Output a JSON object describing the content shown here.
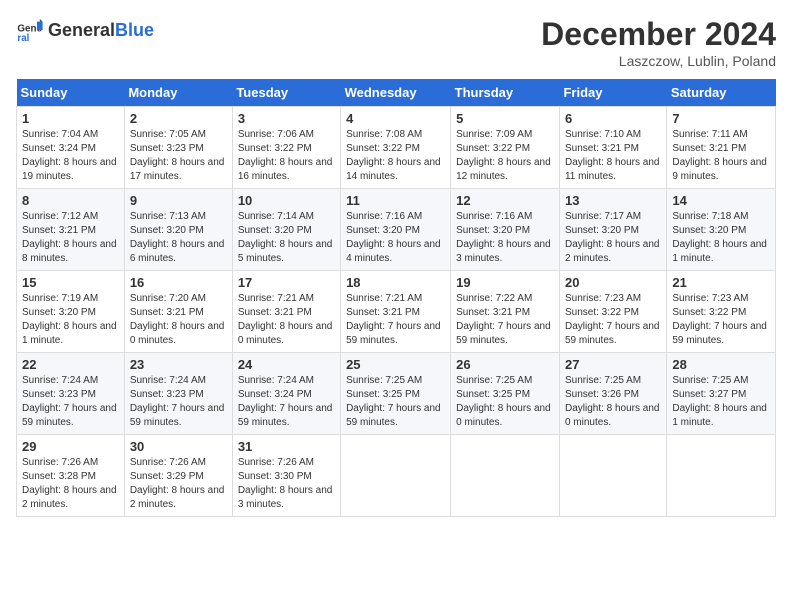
{
  "header": {
    "logo": {
      "general": "General",
      "blue": "Blue"
    },
    "title": "December 2024",
    "location": "Laszczow, Lublin, Poland"
  },
  "calendar": {
    "columns": [
      "Sunday",
      "Monday",
      "Tuesday",
      "Wednesday",
      "Thursday",
      "Friday",
      "Saturday"
    ],
    "weeks": [
      [
        {
          "day": "1",
          "sunrise": "7:04 AM",
          "sunset": "3:24 PM",
          "daylight": "8 hours and 19 minutes."
        },
        {
          "day": "2",
          "sunrise": "7:05 AM",
          "sunset": "3:23 PM",
          "daylight": "8 hours and 17 minutes."
        },
        {
          "day": "3",
          "sunrise": "7:06 AM",
          "sunset": "3:22 PM",
          "daylight": "8 hours and 16 minutes."
        },
        {
          "day": "4",
          "sunrise": "7:08 AM",
          "sunset": "3:22 PM",
          "daylight": "8 hours and 14 minutes."
        },
        {
          "day": "5",
          "sunrise": "7:09 AM",
          "sunset": "3:22 PM",
          "daylight": "8 hours and 12 minutes."
        },
        {
          "day": "6",
          "sunrise": "7:10 AM",
          "sunset": "3:21 PM",
          "daylight": "8 hours and 11 minutes."
        },
        {
          "day": "7",
          "sunrise": "7:11 AM",
          "sunset": "3:21 PM",
          "daylight": "8 hours and 9 minutes."
        }
      ],
      [
        {
          "day": "8",
          "sunrise": "7:12 AM",
          "sunset": "3:21 PM",
          "daylight": "8 hours and 8 minutes."
        },
        {
          "day": "9",
          "sunrise": "7:13 AM",
          "sunset": "3:20 PM",
          "daylight": "8 hours and 6 minutes."
        },
        {
          "day": "10",
          "sunrise": "7:14 AM",
          "sunset": "3:20 PM",
          "daylight": "8 hours and 5 minutes."
        },
        {
          "day": "11",
          "sunrise": "7:16 AM",
          "sunset": "3:20 PM",
          "daylight": "8 hours and 4 minutes."
        },
        {
          "day": "12",
          "sunrise": "7:16 AM",
          "sunset": "3:20 PM",
          "daylight": "8 hours and 3 minutes."
        },
        {
          "day": "13",
          "sunrise": "7:17 AM",
          "sunset": "3:20 PM",
          "daylight": "8 hours and 2 minutes."
        },
        {
          "day": "14",
          "sunrise": "7:18 AM",
          "sunset": "3:20 PM",
          "daylight": "8 hours and 1 minute."
        }
      ],
      [
        {
          "day": "15",
          "sunrise": "7:19 AM",
          "sunset": "3:20 PM",
          "daylight": "8 hours and 1 minute."
        },
        {
          "day": "16",
          "sunrise": "7:20 AM",
          "sunset": "3:21 PM",
          "daylight": "8 hours and 0 minutes."
        },
        {
          "day": "17",
          "sunrise": "7:21 AM",
          "sunset": "3:21 PM",
          "daylight": "8 hours and 0 minutes."
        },
        {
          "day": "18",
          "sunrise": "7:21 AM",
          "sunset": "3:21 PM",
          "daylight": "7 hours and 59 minutes."
        },
        {
          "day": "19",
          "sunrise": "7:22 AM",
          "sunset": "3:21 PM",
          "daylight": "7 hours and 59 minutes."
        },
        {
          "day": "20",
          "sunrise": "7:23 AM",
          "sunset": "3:22 PM",
          "daylight": "7 hours and 59 minutes."
        },
        {
          "day": "21",
          "sunrise": "7:23 AM",
          "sunset": "3:22 PM",
          "daylight": "7 hours and 59 minutes."
        }
      ],
      [
        {
          "day": "22",
          "sunrise": "7:24 AM",
          "sunset": "3:23 PM",
          "daylight": "7 hours and 59 minutes."
        },
        {
          "day": "23",
          "sunrise": "7:24 AM",
          "sunset": "3:23 PM",
          "daylight": "7 hours and 59 minutes."
        },
        {
          "day": "24",
          "sunrise": "7:24 AM",
          "sunset": "3:24 PM",
          "daylight": "7 hours and 59 minutes."
        },
        {
          "day": "25",
          "sunrise": "7:25 AM",
          "sunset": "3:25 PM",
          "daylight": "7 hours and 59 minutes."
        },
        {
          "day": "26",
          "sunrise": "7:25 AM",
          "sunset": "3:25 PM",
          "daylight": "8 hours and 0 minutes."
        },
        {
          "day": "27",
          "sunrise": "7:25 AM",
          "sunset": "3:26 PM",
          "daylight": "8 hours and 0 minutes."
        },
        {
          "day": "28",
          "sunrise": "7:25 AM",
          "sunset": "3:27 PM",
          "daylight": "8 hours and 1 minute."
        }
      ],
      [
        {
          "day": "29",
          "sunrise": "7:26 AM",
          "sunset": "3:28 PM",
          "daylight": "8 hours and 2 minutes."
        },
        {
          "day": "30",
          "sunrise": "7:26 AM",
          "sunset": "3:29 PM",
          "daylight": "8 hours and 2 minutes."
        },
        {
          "day": "31",
          "sunrise": "7:26 AM",
          "sunset": "3:30 PM",
          "daylight": "8 hours and 3 minutes."
        },
        null,
        null,
        null,
        null
      ]
    ]
  }
}
